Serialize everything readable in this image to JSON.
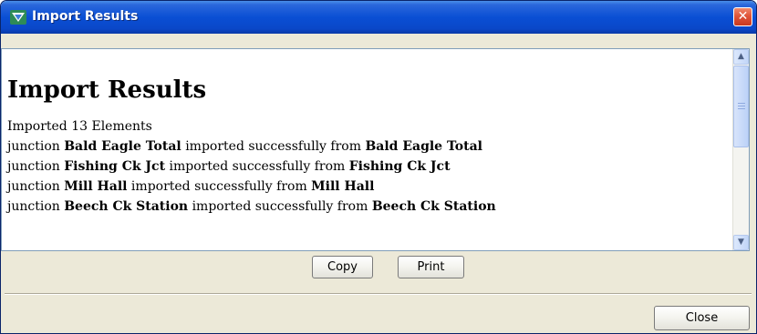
{
  "window": {
    "title": "Import Results",
    "close_glyph": "✕"
  },
  "results": {
    "heading": "Import Results",
    "summary": "Imported 13 Elements",
    "lines": [
      {
        "prefix": "junction ",
        "element": "Bald Eagle Total",
        "middle": " imported successfully from ",
        "source": "Bald Eagle Total"
      },
      {
        "prefix": "junction ",
        "element": "Fishing Ck Jct",
        "middle": " imported successfully from ",
        "source": "Fishing Ck Jct"
      },
      {
        "prefix": "junction ",
        "element": "Mill Hall",
        "middle": " imported successfully from ",
        "source": "Mill Hall"
      },
      {
        "prefix": "junction ",
        "element": "Beech Ck Station",
        "middle": " imported successfully from ",
        "source": "Beech Ck Station"
      }
    ]
  },
  "buttons": {
    "copy": "Copy",
    "print": "Print",
    "close": "Close"
  },
  "icons": {
    "app": "hec-hms-icon",
    "scroll_up": "chevron-up-icon",
    "scroll_down": "chevron-down-icon"
  },
  "colors": {
    "titlebar": "#0a4fd4",
    "close_button": "#e0553a",
    "dialog_background": "#ece9d8"
  }
}
